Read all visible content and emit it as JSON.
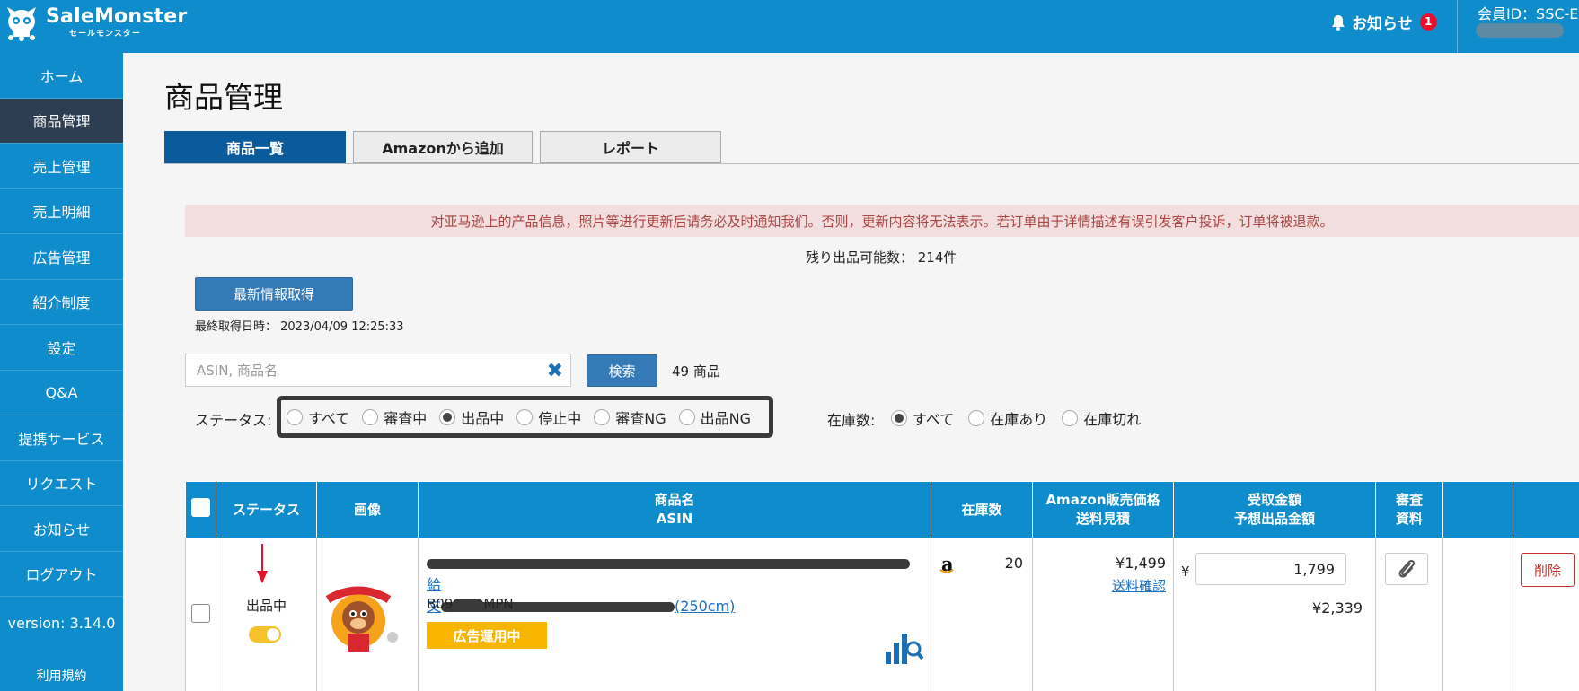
{
  "brand": {
    "name": "SaleMonster",
    "sub": "セールモンスター"
  },
  "header": {
    "notice_label": "お知らせ",
    "notice_count": "1",
    "member_id": "会員ID：SSC-E"
  },
  "sidebar": {
    "items": [
      {
        "label": "ホーム"
      },
      {
        "label": "商品管理",
        "active": true
      },
      {
        "label": "売上管理"
      },
      {
        "label": "売上明細"
      },
      {
        "label": "広告管理"
      },
      {
        "label": "紹介制度"
      },
      {
        "label": "設定"
      },
      {
        "label": "Q&A"
      },
      {
        "label": "提携サービス"
      },
      {
        "label": "リクエスト"
      },
      {
        "label": "お知らせ"
      },
      {
        "label": "ログアウト"
      }
    ],
    "version": "version: 3.14.0",
    "terms": "利用規約"
  },
  "page": {
    "title": "商品管理",
    "tabs": [
      {
        "label": "商品一覧",
        "active": true
      },
      {
        "label": "Amazonから追加"
      },
      {
        "label": "レポート"
      }
    ],
    "alert": "对亚马逊上的产品信息，照片等进行更新后请务必及时通知我们。否则，更新内容将无法表示。若订单由于详情描述有误引发客户投诉，订单将被退款。",
    "remaining": "残り出品可能数： 214件",
    "refresh_button": "最新情報取得",
    "last_fetched": "最終取得日時： 2023/04/09 12:25:33"
  },
  "search": {
    "placeholder": "ASIN, 商品名",
    "value": "",
    "button": "検索",
    "result_count": "49 商品"
  },
  "filters": {
    "status_label": "ステータス:",
    "status_options": [
      {
        "label": "すべて",
        "checked": false
      },
      {
        "label": "審査中",
        "checked": false
      },
      {
        "label": "出品中",
        "checked": true
      },
      {
        "label": "停止中",
        "checked": false
      },
      {
        "label": "審査NG",
        "checked": false
      },
      {
        "label": "出品NG",
        "checked": false
      }
    ],
    "stock_label": "在庫数:",
    "stock_options": [
      {
        "label": "すべて",
        "checked": true
      },
      {
        "label": "在庫あり",
        "checked": false
      },
      {
        "label": "在庫切れ",
        "checked": false
      }
    ]
  },
  "table": {
    "headers": {
      "status": "ステータス",
      "image": "画像",
      "name_line1": "商品名",
      "name_line2": "ASIN",
      "stock": "在庫数",
      "price_line1": "Amazon販売価格",
      "price_line2": "送料見積",
      "amount_line1": "受取金額",
      "amount_line2": "予想出品金額",
      "review_line1": "審査",
      "review_line2": "資料"
    },
    "rows": [
      {
        "status": "出品中",
        "toggle_on": true,
        "name_suffix_link": "(250cm)",
        "name_char_1": "給",
        "name_char_2": "文",
        "asin_prefix": "B09",
        "asin_suffix": "MPN",
        "ad_badge": "広告運用中",
        "stock": "20",
        "price": "¥1,499",
        "shipping_link": "送料確認",
        "yen_symbol": "¥",
        "amount_value": "1,799",
        "expected": "¥2,339",
        "delete_label": "削除"
      }
    ]
  },
  "colors": {
    "primary": "#0e8ccb",
    "sidebar_active": "#2d3e52",
    "tab_active": "#0a5a9c",
    "button": "#337ab7",
    "alert_bg": "#f2dede",
    "alert_text": "#a94442",
    "badge": "#f8b500",
    "toggle": "#f5c22b",
    "danger": "#c9302c"
  }
}
